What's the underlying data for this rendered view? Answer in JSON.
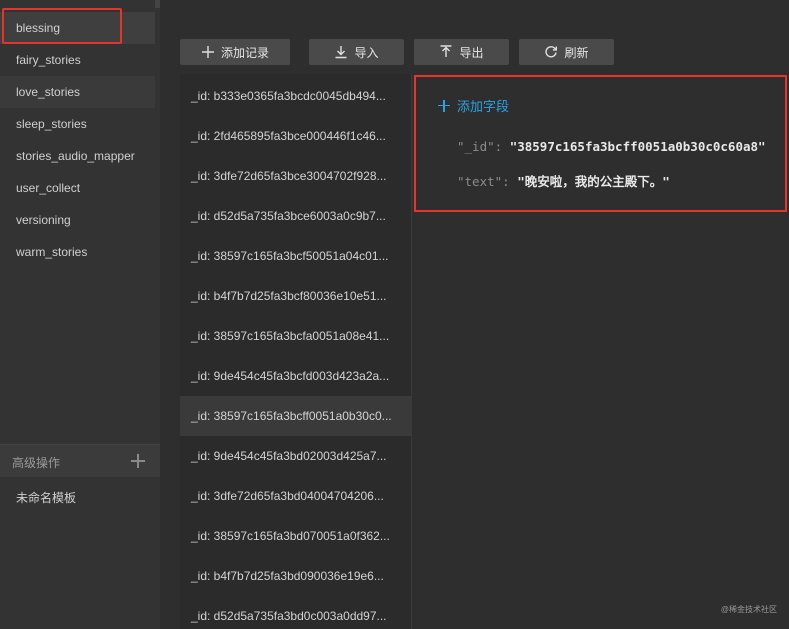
{
  "collections": {
    "items": [
      "blessing",
      "fairy_stories",
      "love_stories",
      "sleep_stories",
      "stories_audio_mapper",
      "user_collect",
      "versioning",
      "warm_stories"
    ],
    "selected": "blessing"
  },
  "advanced": {
    "label": "高级操作",
    "template": "未命名模板"
  },
  "toolbar": {
    "add_label": "添加记录",
    "import_label": "导入",
    "export_label": "导出",
    "refresh_label": "刷新"
  },
  "records": [
    "_id: b333e0365fa3bcdc0045db494...",
    "_id: 2fd465895fa3bce000446f1c46...",
    "_id: 3dfe72d65fa3bce3004702f928...",
    "_id: d52d5a735fa3bce6003a0c9b7...",
    "_id: 38597c165fa3bcf50051a04c01...",
    "_id: b4f7b7d25fa3bcf80036e10e51...",
    "_id: 38597c165fa3bcfa0051a08e41...",
    "_id: 9de454c45fa3bcfd003d423a2a...",
    "_id: 38597c165fa3bcff0051a0b30c0...",
    "_id: 9de454c45fa3bd02003d425a7...",
    "_id: 3dfe72d65fa3bd04004704206...",
    "_id: 38597c165fa3bd070051a0f362...",
    "_id: b4f7b7d25fa3bd090036e19e6...",
    "_id: d52d5a735fa3bd0c003a0dd97..."
  ],
  "active_record_index": 8,
  "detail": {
    "add_field_label": "添加字段",
    "fields": [
      {
        "key": "\"_id\":",
        "value": "\"38597c165fa3bcff0051a0b30c0c60a8\""
      },
      {
        "key": "\"text\":",
        "value": "\"晚安啦，我的公主殿下。\""
      }
    ]
  },
  "watermark": "@稀金技术社区",
  "colors": {
    "highlight_border": "#e8332b",
    "accent": "#2aa3e3"
  }
}
